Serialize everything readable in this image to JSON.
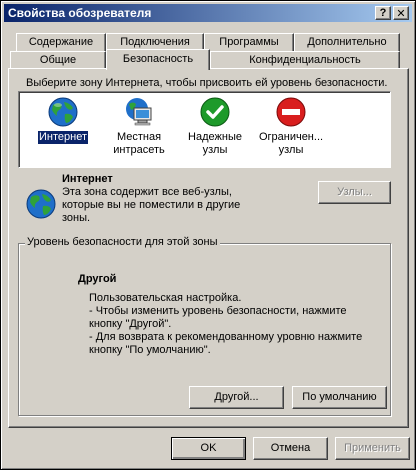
{
  "window": {
    "title": "Свойства обозревателя",
    "help_glyph": "?",
    "close_glyph": "x"
  },
  "tabs_back": [
    "Содержание",
    "Подключения",
    "Программы",
    "Дополнительно"
  ],
  "tabs_front": [
    "Общие",
    "Безопасность",
    "Конфиденциальность"
  ],
  "active_tab": "Безопасность",
  "zones_intro": "Выберите зону Интернета, чтобы присвоить ей уровень безопасности.",
  "zones": [
    {
      "label_line1": "Интернет",
      "label_line2": "",
      "icon": "globe-icon",
      "selected": true
    },
    {
      "label_line1": "Местная",
      "label_line2": "интрасеть",
      "icon": "network-computer-icon",
      "selected": false
    },
    {
      "label_line1": "Надежные",
      "label_line2": "узлы",
      "icon": "check-icon",
      "selected": false
    },
    {
      "label_line1": "Ограничен...",
      "label_line2": "узлы",
      "icon": "restricted-icon",
      "selected": false
    }
  ],
  "zone_info": {
    "name": "Интернет",
    "desc_lines": [
      "Эта зона содержит все веб-узлы,",
      "которые вы не поместили в другие",
      "зоны."
    ],
    "sites_button": "Узлы..."
  },
  "security_level": {
    "group_title": "Уровень безопасности для этой зоны",
    "level_name": "Другой",
    "lines": [
      "Пользовательская настройка.",
      "- Чтобы изменить уровень безопасности, нажмите",
      "кнопку \"Другой\".",
      "- Для возврата к рекомендованному уровню нажмите",
      "кнопку \"По умолчанию\"."
    ],
    "custom_button": "Другой...",
    "default_button": "По умолчанию"
  },
  "footer": {
    "ok": "OK",
    "cancel": "Отмена",
    "apply": "Применить"
  },
  "colors": {
    "title_gradient_start": "#0A246A",
    "title_gradient_end": "#A6CAF0",
    "selection": "#0A246A",
    "face": "#D4D0C8"
  }
}
